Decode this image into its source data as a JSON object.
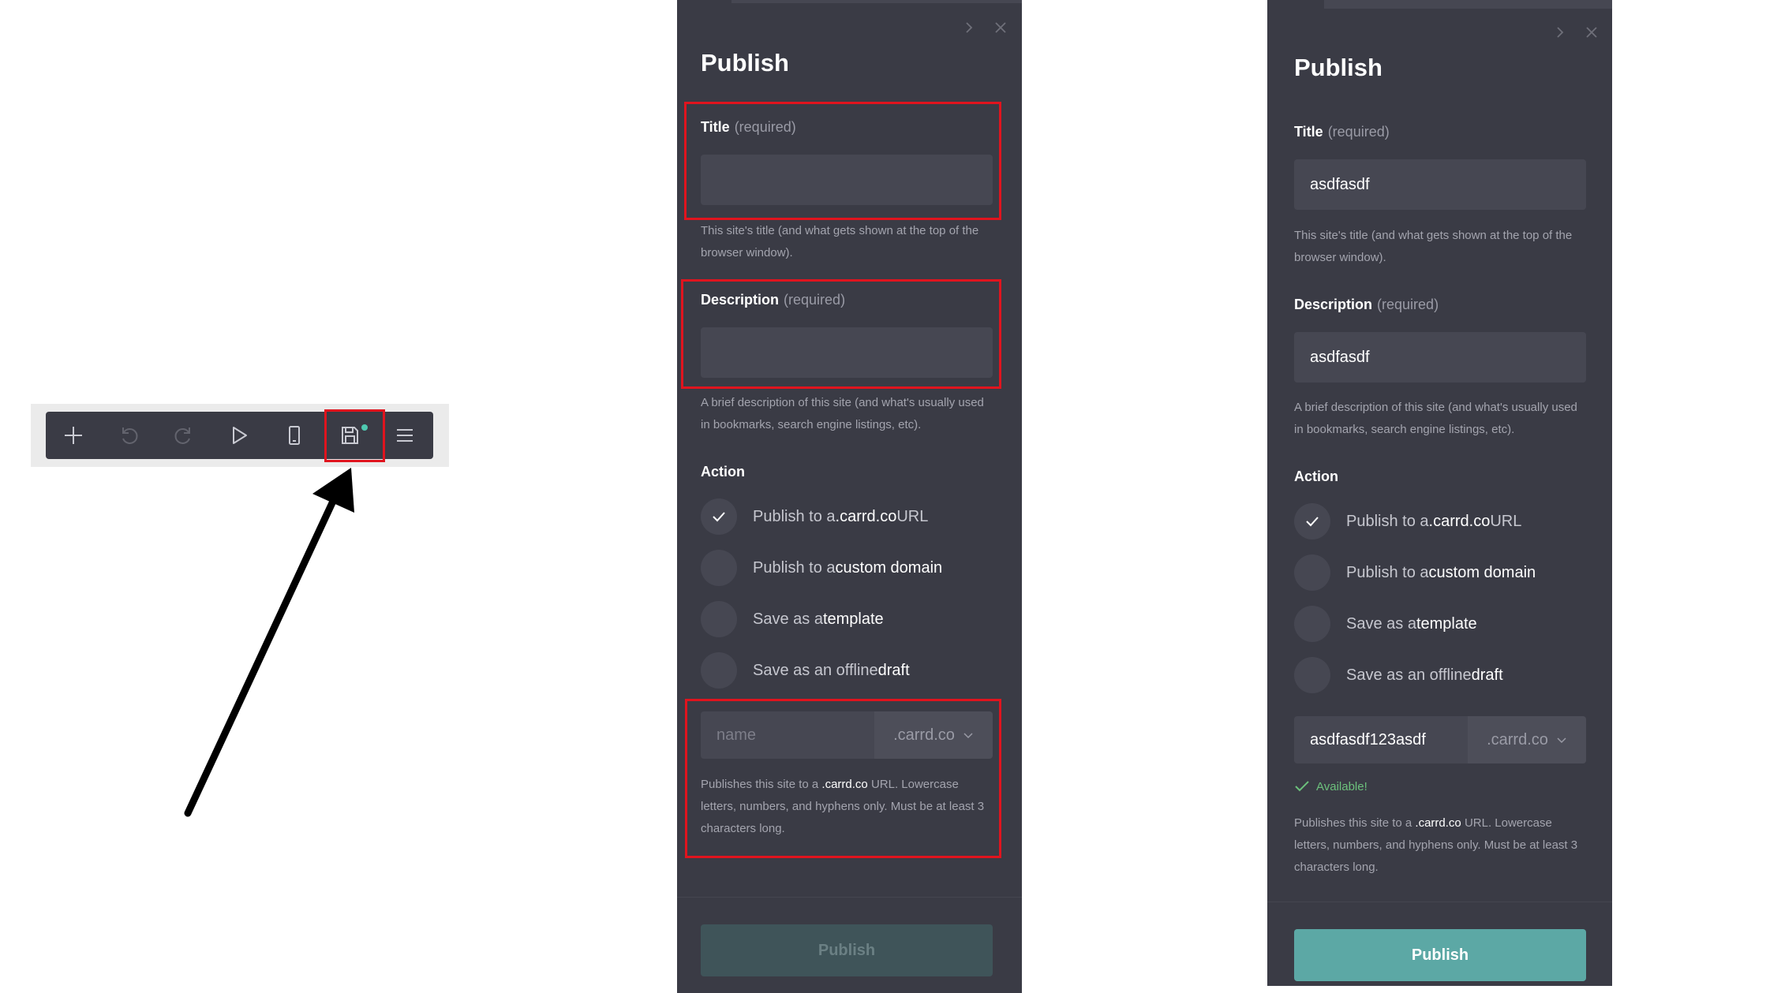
{
  "colors": {
    "panel_bg": "#3a3b45",
    "input_bg": "#464752",
    "accent": "#5ca8a5",
    "accent_disabled": "#3f5459",
    "highlight": "#e0141e",
    "available": "#6cc07c",
    "status_dot": "#4ec9b0"
  },
  "toolbar": {
    "buttons": [
      {
        "icon": "plus-icon"
      },
      {
        "icon": "undo-icon"
      },
      {
        "icon": "redo-icon"
      },
      {
        "icon": "play-icon"
      },
      {
        "icon": "mobile-icon"
      },
      {
        "icon": "save-icon",
        "has_dot": true
      },
      {
        "icon": "menu-icon"
      }
    ]
  },
  "panel_empty": {
    "title": "Publish",
    "title_label": "Title",
    "title_required": "(required)",
    "title_value": "",
    "title_help": "This site's title (and what gets shown at the top of the browser window).",
    "description_label": "Description",
    "description_required": "(required)",
    "description_value": "",
    "description_help": "A brief description of this site (and what's usually used in bookmarks, search engine listings, etc).",
    "action_label": "Action",
    "options": [
      {
        "prefix": "Publish to a ",
        "em": ".carrd.co",
        "suffix": " URL",
        "checked": true
      },
      {
        "prefix": "Publish to a ",
        "em": "custom domain",
        "suffix": "",
        "checked": false
      },
      {
        "prefix": "Save as a ",
        "em": "template",
        "suffix": "",
        "checked": false
      },
      {
        "prefix": "Save as an offline ",
        "em": "draft",
        "suffix": "",
        "checked": false
      }
    ],
    "url_placeholder": "name",
    "url_value": "",
    "url_domain": ".carrd.co",
    "url_help_prefix": "Publishes this site to a ",
    "url_help_em": ".carrd.co",
    "url_help_suffix": " URL. Lowercase letters, numbers, and hyphens only. Must be at least 3 characters long.",
    "publish_label": "Publish"
  },
  "panel_filled": {
    "title": "Publish",
    "title_label": "Title",
    "title_required": "(required)",
    "title_value": "asdfasdf",
    "title_help": "This site's title (and what gets shown at the top of the browser window).",
    "description_label": "Description",
    "description_required": "(required)",
    "description_value": "asdfasdf",
    "description_help": "A brief description of this site (and what's usually used in bookmarks, search engine listings, etc).",
    "action_label": "Action",
    "options": [
      {
        "prefix": "Publish to a ",
        "em": ".carrd.co",
        "suffix": " URL",
        "checked": true
      },
      {
        "prefix": "Publish to a ",
        "em": "custom domain",
        "suffix": "",
        "checked": false
      },
      {
        "prefix": "Save as a ",
        "em": "template",
        "suffix": "",
        "checked": false
      },
      {
        "prefix": "Save as an offline ",
        "em": "draft",
        "suffix": "",
        "checked": false
      }
    ],
    "url_value": "asdfasdf123asdf",
    "url_domain": ".carrd.co",
    "available_text": "Available!",
    "url_help_prefix": "Publishes this site to a ",
    "url_help_em": ".carrd.co",
    "url_help_suffix": " URL. Lowercase letters, numbers, and hyphens only. Must be at least 3 characters long.",
    "publish_label": "Publish"
  }
}
